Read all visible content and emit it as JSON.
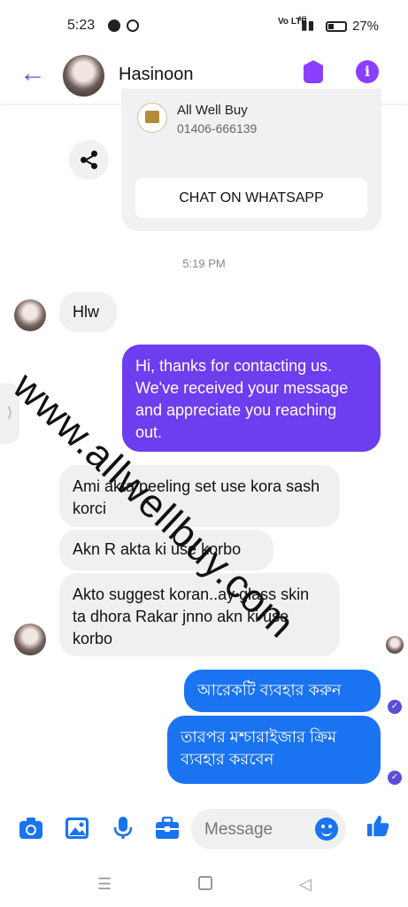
{
  "status_bar": {
    "time": "5:23",
    "network": "Vo LTE",
    "signal": "4G",
    "battery": "27%",
    "notification_icons": [
      "messenger-icon",
      "messenger-outline-icon"
    ]
  },
  "header": {
    "contact_name": "Hasinoon",
    "back_icon": "arrow-left-icon",
    "actions": [
      "tag-icon",
      "info-icon"
    ],
    "accent": "#8a3ffc"
  },
  "shared_card": {
    "business_name": "All Well Buy",
    "phone": "01406-666139",
    "button_label": "CHAT ON WHATSAPP"
  },
  "timestamp": "5:19 PM",
  "messages": [
    {
      "from": "contact",
      "text": "Hlw"
    },
    {
      "from": "me",
      "text": "Hi, thanks for contacting us. We've received your message and appreciate you reaching out."
    },
    {
      "from": "contact",
      "text": "Ami akta peeling set use kora sash korci"
    },
    {
      "from": "contact",
      "text": "Akn R akta ki use korbo"
    },
    {
      "from": "contact",
      "text": "Akto suggest koran..ay glass skin ta dhora Rakar jnno akn ki use korbo"
    },
    {
      "from": "me",
      "text": "আরেকটি ব্যবহার করুন"
    },
    {
      "from": "me",
      "text": "তারপর মশ্চারাইজার ক্রিম ব্যবহার করবেন"
    }
  ],
  "watermark": "www.allwellbuy.com",
  "composer": {
    "placeholder": "Message",
    "icons": [
      "camera-icon",
      "image-icon",
      "microphone-icon",
      "briefcase-icon",
      "emoji-icon",
      "thumbs-up-icon"
    ],
    "accent": "#1a73f0"
  },
  "colors": {
    "outgoing_purple": "#6d3df0",
    "outgoing_blue": "#1a73f0",
    "incoming": "#f0f0f0"
  }
}
